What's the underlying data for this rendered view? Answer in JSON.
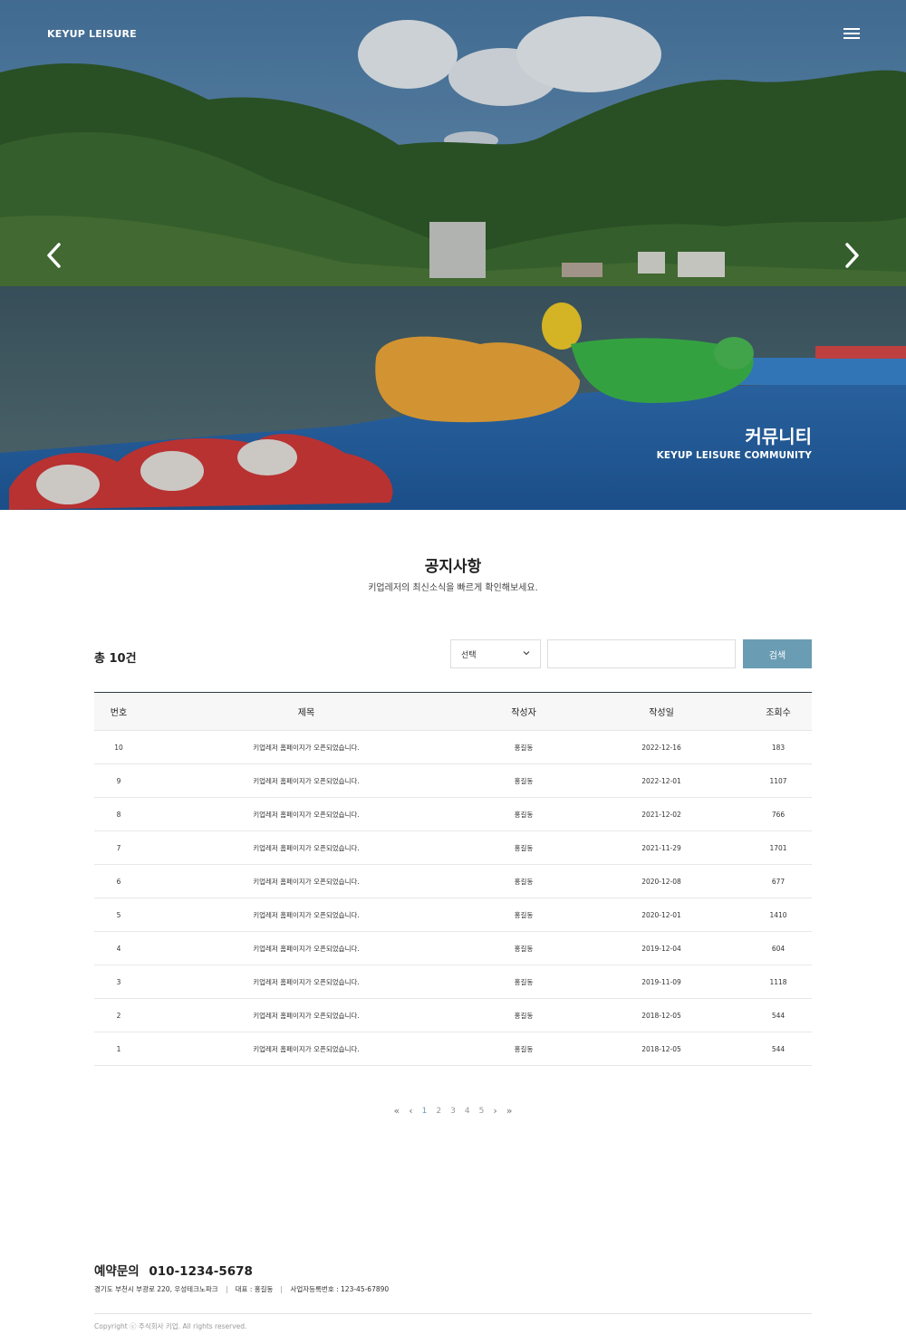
{
  "header": {
    "logo": "KEYUP LEISURE",
    "menu_icon": "hamburger-menu-icon"
  },
  "hero": {
    "title": "커뮤니티",
    "subtitle": "KEYUP LEISURE COMMUNITY",
    "prev_icon": "chevron-left-icon",
    "next_icon": "chevron-right-icon"
  },
  "section": {
    "title": "공지사항",
    "description": "키업레저의 최신소식을 빠르게 확인해보세요."
  },
  "search": {
    "total_prefix": "총",
    "total_count": "10건",
    "select_value": "선택",
    "input_value": "",
    "button_label": "검색"
  },
  "table": {
    "headers": [
      "번호",
      "제목",
      "작성자",
      "작성일",
      "조회수"
    ],
    "rows": [
      {
        "no": "10",
        "title": "키업레저 홈페이지가 오픈되었습니다.",
        "author": "홍길동",
        "date": "2022-12-16",
        "views": "183"
      },
      {
        "no": "9",
        "title": "키업레저 홈페이지가 오픈되었습니다.",
        "author": "홍길동",
        "date": "2022-12-01",
        "views": "1107"
      },
      {
        "no": "8",
        "title": "키업레저 홈페이지가 오픈되었습니다.",
        "author": "홍길동",
        "date": "2021-12-02",
        "views": "766"
      },
      {
        "no": "7",
        "title": "키업레저 홈페이지가 오픈되었습니다.",
        "author": "홍길동",
        "date": "2021-11-29",
        "views": "1701"
      },
      {
        "no": "6",
        "title": "키업레저 홈페이지가 오픈되었습니다.",
        "author": "홍길동",
        "date": "2020-12-08",
        "views": "677"
      },
      {
        "no": "5",
        "title": "키업레저 홈페이지가 오픈되었습니다.",
        "author": "홍길동",
        "date": "2020-12-01",
        "views": "1410"
      },
      {
        "no": "4",
        "title": "키업레저 홈페이지가 오픈되었습니다.",
        "author": "홍길동",
        "date": "2019-12-04",
        "views": "604"
      },
      {
        "no": "3",
        "title": "키업레저 홈페이지가 오픈되었습니다.",
        "author": "홍길동",
        "date": "2019-11-09",
        "views": "1118"
      },
      {
        "no": "2",
        "title": "키업레저 홈페이지가 오픈되었습니다.",
        "author": "홍길동",
        "date": "2018-12-05",
        "views": "544"
      },
      {
        "no": "1",
        "title": "키업레저 홈페이지가 오픈되었습니다.",
        "author": "홍길동",
        "date": "2018-12-05",
        "views": "544"
      }
    ]
  },
  "pagination": {
    "first": "«",
    "prev": "‹",
    "pages": [
      "1",
      "2",
      "3",
      "4",
      "5"
    ],
    "current": "1",
    "next": "›",
    "last": "»"
  },
  "footer": {
    "contact_label": "예약문의",
    "phone": "010-1234-5678",
    "address": "경기도 부천시 부광로 220, 우성테크노파크",
    "ceo": "대표 : 홍길동",
    "biz_no": "사업자등록번호 : 123-45-67890",
    "copyright": "Copyright ⓒ 주식회사 키업. All rights reserved."
  },
  "colors": {
    "accent": "#6a9db3",
    "table_border": "#2f3e46"
  }
}
